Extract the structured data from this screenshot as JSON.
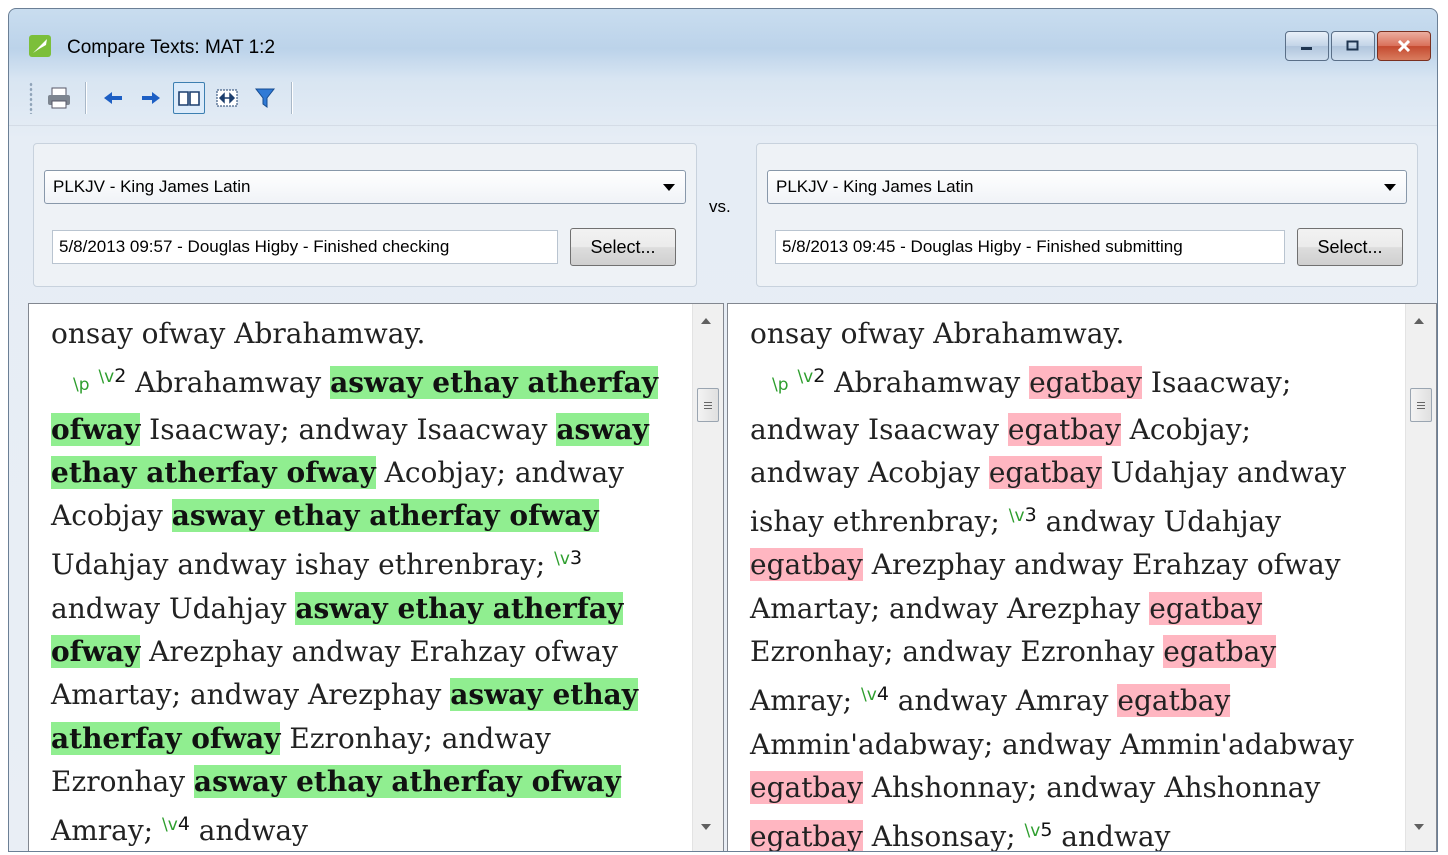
{
  "window": {
    "title": "Compare Texts: MAT 1:2",
    "buttons": [
      "minimize-icon",
      "maximize-icon",
      "close-icon"
    ]
  },
  "toolbar": {
    "items": [
      "print-icon",
      "arrow-left-icon",
      "arrow-right-icon",
      "book-icon",
      "fit-width-icon",
      "filter-icon"
    ]
  },
  "left": {
    "project": "PLKJV - King James Latin",
    "revision": "5/8/2013 09:57 - Douglas Higby - Finished checking",
    "select_label": "Select..."
  },
  "right": {
    "project": "PLKJV - King James Latin",
    "revision": "5/8/2013 09:45 - Douglas Higby - Finished submitting",
    "select_label": "Select..."
  },
  "vs_label": "vs.",
  "colors": {
    "insert": "#90ee90",
    "delete": "#ffb6c1",
    "marker": "#2e9e2e"
  },
  "left_text": {
    "t1": "onsay ofway Abrahamway.",
    "p_marker": "\\p",
    "v_marker": "\\v",
    "v2": "2",
    "t2": " Abrahamway ",
    "g1": "asway ethay atherfay ofway",
    "t3": " Isaacway; andway Isaacway ",
    "g2": "asway ethay atherfay ofway",
    "t4": " Acobjay; andway Acobjay ",
    "g3": "asway ethay atherfay ofway",
    "t5": " Udahjay andway ishay ethrenbray; ",
    "v3": "3",
    "t6": " andway Udahjay ",
    "g4": "asway ethay atherfay ofway",
    "t7": " Arezphay andway Erahzay ofway Amartay; andway Arezphay ",
    "g5": "asway ethay atherfay ofway",
    "t8": " Ezronhay; andway Ezronhay ",
    "g6": "asway ethay atherfay ofway",
    "t9": " Amray; ",
    "v4": "4",
    "t10": " andway"
  },
  "right_text": {
    "t1": "onsay ofway Abrahamway.",
    "p_marker": "\\p",
    "v_marker": "\\v",
    "v2": "2",
    "t2": " Abrahamway ",
    "r1": "egatbay",
    "t3": " Isaacway; andway Isaacway ",
    "r2": "egatbay",
    "t4": " Acobjay; andway Acobjay ",
    "r3": "egatbay",
    "t5": " Udahjay andway ishay ethrenbray; ",
    "v3": "3",
    "t6": " andway Udahjay ",
    "r4": "egatbay",
    "t7": " Arezphay andway Erahzay ofway Amartay; andway Arezphay ",
    "r5": "egatbay",
    "t8": " Ezronhay; andway Ezronhay ",
    "r6": "egatbay",
    "t9": " Amray; ",
    "v4": "4",
    "t10": " andway Amray ",
    "r7": "egatbay",
    "t11": " Ammin'adabway; andway Ammin'adabway ",
    "r8": "egatbay",
    "t12": " Ahshonnay; andway Ahshonnay ",
    "r9": "egatbay",
    "t13": " Ahsonsay; ",
    "v5": "5",
    "t14": " andway"
  }
}
